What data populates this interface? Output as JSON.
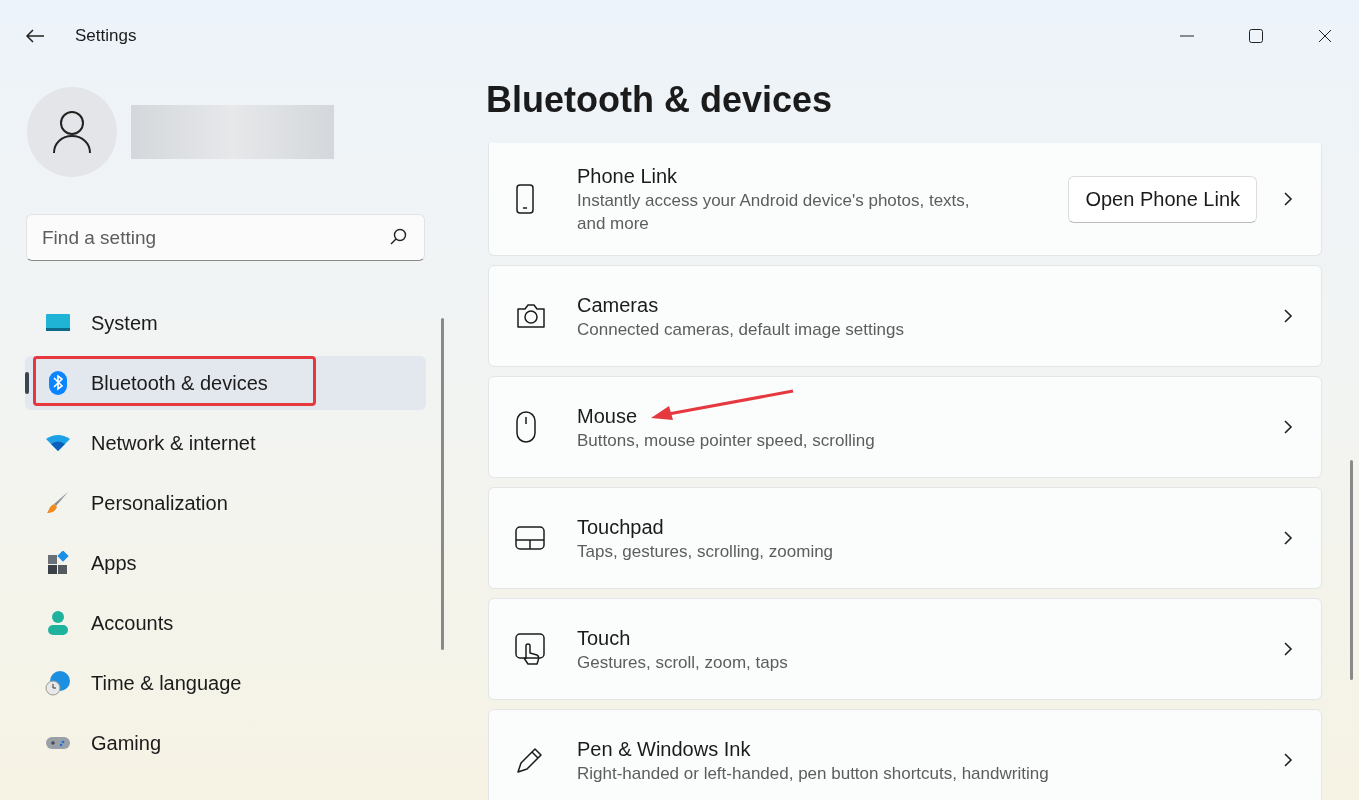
{
  "window": {
    "title": "Settings"
  },
  "search": {
    "placeholder": "Find a setting"
  },
  "sidebar": {
    "items": [
      {
        "label": "System",
        "selected": false
      },
      {
        "label": "Bluetooth & devices",
        "selected": true
      },
      {
        "label": "Network & internet",
        "selected": false
      },
      {
        "label": "Personalization",
        "selected": false
      },
      {
        "label": "Apps",
        "selected": false
      },
      {
        "label": "Accounts",
        "selected": false
      },
      {
        "label": "Time & language",
        "selected": false
      },
      {
        "label": "Gaming",
        "selected": false
      }
    ]
  },
  "page": {
    "title": "Bluetooth & devices",
    "rows": [
      {
        "title": "Phone Link",
        "subtitle": "Instantly access your Android device's photos, texts, and more",
        "button": "Open Phone Link"
      },
      {
        "title": "Cameras",
        "subtitle": "Connected cameras, default image settings"
      },
      {
        "title": "Mouse",
        "subtitle": "Buttons, mouse pointer speed, scrolling"
      },
      {
        "title": "Touchpad",
        "subtitle": "Taps, gestures, scrolling, zooming"
      },
      {
        "title": "Touch",
        "subtitle": "Gestures, scroll, zoom, taps"
      },
      {
        "title": "Pen & Windows Ink",
        "subtitle": "Right-handed or left-handed, pen button shortcuts, handwriting"
      }
    ]
  }
}
